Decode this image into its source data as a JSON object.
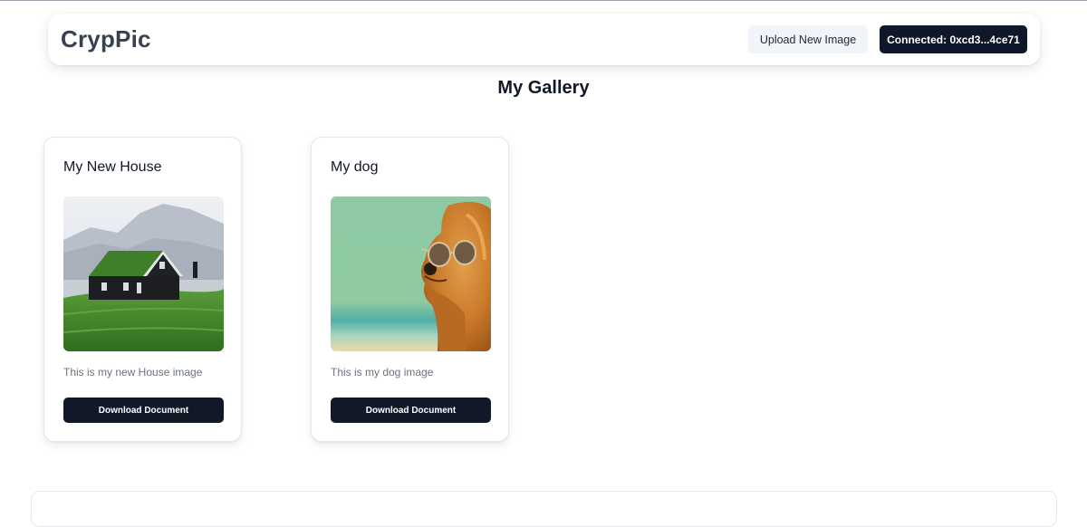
{
  "navbar": {
    "brand": "CrypPic",
    "upload_label": "Upload New Image",
    "connected_label": "Connected: 0xcd3...4ce71"
  },
  "gallery": {
    "title": "My Gallery",
    "cards": [
      {
        "title": "My New House",
        "image": "house-photo",
        "description": "This is my new House image",
        "button_label": "Download Document"
      },
      {
        "title": "My dog",
        "image": "dog-photo",
        "description": "This is my dog image",
        "button_label": "Download Document"
      }
    ]
  },
  "colors": {
    "primary_dark": "#111827",
    "secondary_button": "#f1f5f9",
    "muted_text": "#6b7280"
  }
}
